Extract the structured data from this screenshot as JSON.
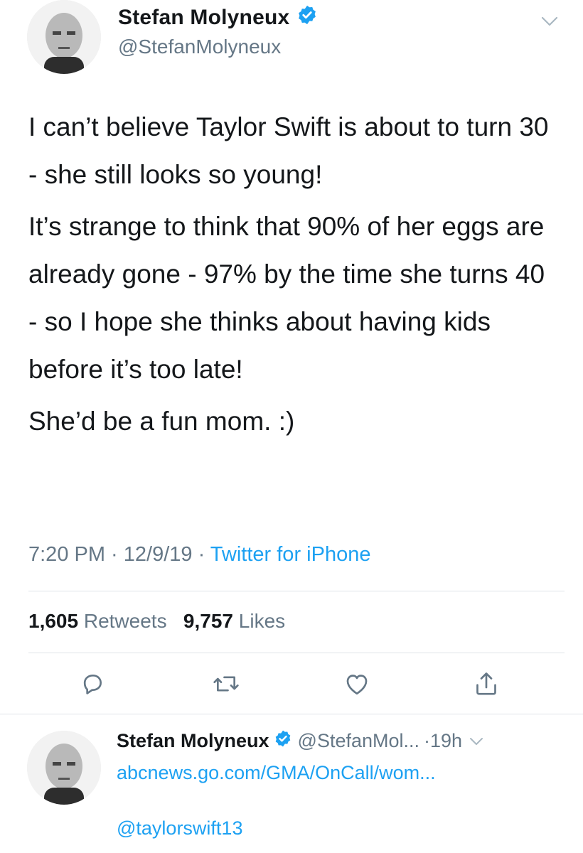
{
  "main_tweet": {
    "author": {
      "name": "Stefan Molyneux",
      "handle": "@StefanMolyneux",
      "verified_icon": "verified-badge-icon"
    },
    "body_paragraphs": [
      "I can’t believe Taylor Swift is about to turn 30 - she still looks so young!",
      "It’s strange to think that 90% of her eggs are already gone - 97% by the time she turns 40 - so I hope she thinks about having kids before it’s too late!",
      "She’d be a fun mom. :)"
    ],
    "meta": {
      "time": "7:20 PM",
      "separator1": " · ",
      "date": "12/9/19",
      "separator2": " · ",
      "source": "Twitter for iPhone"
    },
    "stats": {
      "retweets_count": "1,605",
      "retweets_label": "Retweets",
      "likes_count": "9,757",
      "likes_label": "Likes"
    },
    "actions": [
      {
        "name": "reply",
        "icon": "reply-icon"
      },
      {
        "name": "retweet",
        "icon": "retweet-icon"
      },
      {
        "name": "like",
        "icon": "heart-icon"
      },
      {
        "name": "share",
        "icon": "share-icon"
      }
    ]
  },
  "reply_tweet": {
    "author": {
      "name": "Stefan Molyneux",
      "handle": "@StefanMol...",
      "time": "·19h"
    },
    "link": "abcnews.go.com/GMA/OnCall/wom...",
    "mention": "@taylorswift13"
  },
  "colors": {
    "text_primary": "#14171a",
    "text_secondary": "#657786",
    "accent_blue": "#1da1f2",
    "divider": "#dfe3e8"
  }
}
